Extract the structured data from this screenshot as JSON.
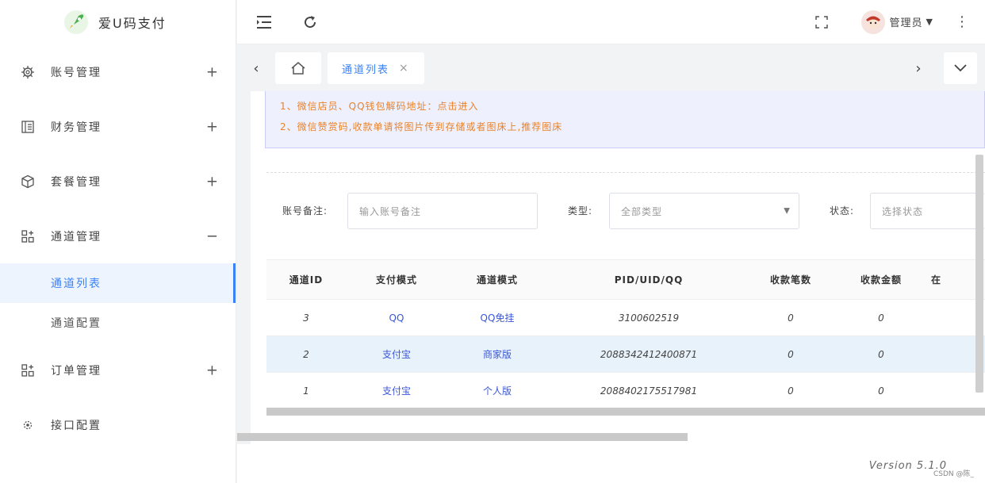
{
  "app": {
    "title": "爱U码支付"
  },
  "sidebar": {
    "items": [
      {
        "label": "账号管理",
        "toggle": "+"
      },
      {
        "label": "财务管理",
        "toggle": "+"
      },
      {
        "label": "套餐管理",
        "toggle": "+"
      },
      {
        "label": "通道管理",
        "toggle": "−"
      },
      {
        "label": "订单管理",
        "toggle": "+"
      },
      {
        "label": "接口配置"
      }
    ],
    "sub_items": [
      {
        "label": "通道列表"
      },
      {
        "label": "通道配置"
      }
    ]
  },
  "header": {
    "user_name": "管理员"
  },
  "tabs": {
    "active_label": "通道列表",
    "close": "×"
  },
  "notice": {
    "line1": "1、微信店员、QQ钱包解码地址：点击进入",
    "line2": "2、微信赞赏码,收款单请将图片传到存储或者图床上,推荐图床"
  },
  "filters": {
    "remark_label": "账号备注:",
    "remark_placeholder": "输入账号备注",
    "type_label": "类型:",
    "type_value": "全部类型",
    "status_label": "状态:",
    "status_value": "选择状态"
  },
  "table": {
    "headers": [
      "通道ID",
      "支付模式",
      "通道模式",
      "PID/UID/QQ",
      "收款笔数",
      "收款金额",
      "在"
    ],
    "rows": [
      [
        "3",
        "QQ",
        "QQ免挂",
        "3100602519",
        "0",
        "0"
      ],
      [
        "2",
        "支付宝",
        "商家版",
        "2088342412400871",
        "0",
        "0"
      ],
      [
        "1",
        "支付宝",
        "个人版",
        "2088402175517981",
        "0",
        "0"
      ]
    ]
  },
  "footer": {
    "version": "Version 5.1.0",
    "watermark": "CSDN @陈_"
  },
  "colors": {
    "accent": "#3b82f6",
    "notice_text": "#e8832b",
    "link": "#3b57d8"
  }
}
